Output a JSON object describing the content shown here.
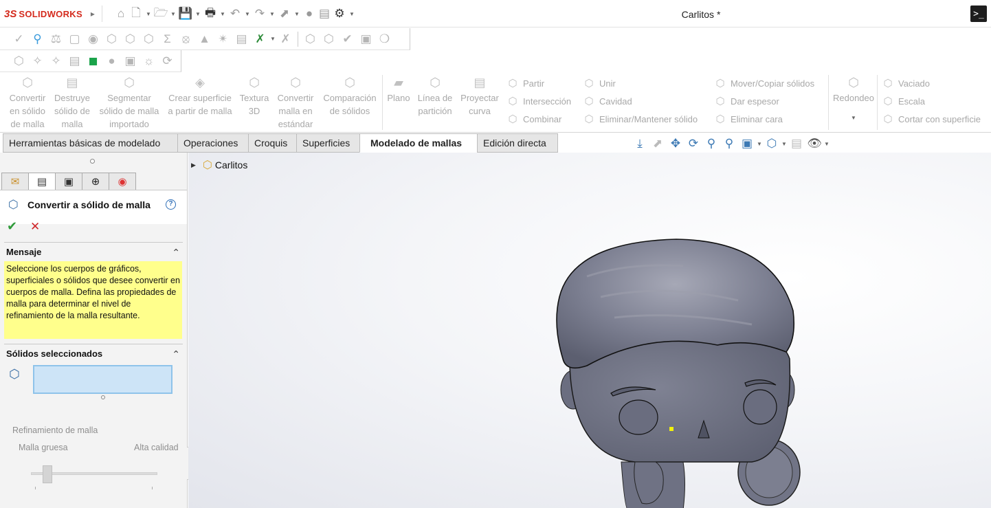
{
  "app": {
    "brand_prefix": "3S",
    "brand": "SOLIDWORKS",
    "document_title": "Carlitos *",
    "terminal_glyph": ">_"
  },
  "quick_access": {
    "icons": [
      "home-icon",
      "new-document-icon",
      "open-icon",
      "save-icon",
      "print-icon",
      "undo-icon",
      "redo-icon",
      "select-icon",
      "rebuild-icon",
      "file-properties-icon",
      "options-gear-icon"
    ]
  },
  "command_manager": {
    "big_buttons": [
      {
        "id": "convertir-solido",
        "label": "Convertir en sólido de malla"
      },
      {
        "id": "destruye-solido",
        "label": "Destruye sólido de malla"
      },
      {
        "id": "segmentar",
        "label": "Segmentar sólido de malla importado"
      },
      {
        "id": "crear-superficie",
        "label": "Crear superficie a partir de malla"
      },
      {
        "id": "textura-3d",
        "label": "Textura 3D"
      },
      {
        "id": "convertir-estandar",
        "label": "Convertir malla en estándar"
      },
      {
        "id": "comparacion",
        "label": "Comparación de sólidos"
      },
      {
        "id": "plano",
        "label": "Plano"
      },
      {
        "id": "linea-particion",
        "label": "Línea de partición"
      },
      {
        "id": "proyectar-curva",
        "label": "Proyectar curva"
      },
      {
        "id": "redondeo",
        "label": "Redondeo"
      }
    ],
    "small_buttons": {
      "col1": [
        "Partir",
        "Intersección",
        "Combinar"
      ],
      "col2": [
        "Unir",
        "Cavidad",
        "Eliminar/Mantener sólido"
      ],
      "col3": [
        "Mover/Copiar sólidos",
        "Dar espesor",
        "Eliminar cara"
      ],
      "col4": [
        "Vaciado",
        "Escala",
        "Cortar con superficie"
      ]
    }
  },
  "tabs": [
    {
      "label": "Herramientas básicas de modelado",
      "active": false
    },
    {
      "label": "Operaciones",
      "active": false
    },
    {
      "label": "Croquis",
      "active": false
    },
    {
      "label": "Superficies",
      "active": false
    },
    {
      "label": "Modelado de mallas",
      "active": true
    },
    {
      "label": "Edición directa",
      "active": false
    }
  ],
  "property_manager": {
    "title": "Convertir a sólido de malla",
    "help": "?",
    "ok_glyph": "✔",
    "cancel_glyph": "✕",
    "sections": {
      "mensaje": {
        "title": "Mensaje",
        "text": "Seleccione los cuerpos de gráficos, superficiales o sólidos que desee convertir en cuerpos de malla. Defina las propiedades de malla para determinar el nivel de refinamiento de la malla resultante."
      },
      "solidos": {
        "title": "Sólidos seleccionados",
        "selected_value": ""
      },
      "refinamiento": {
        "title": "Refinamiento de malla",
        "min_label": "Malla gruesa",
        "max_label": "Alta calidad",
        "slider_position": 0.13
      }
    }
  },
  "feature_tree": {
    "root": "Carlitos"
  },
  "colors": {
    "brand_red": "#d42a1d",
    "message_yellow": "#ffff8c",
    "selection_blue": "#cde4f7",
    "model_grey": "#6f7285"
  }
}
